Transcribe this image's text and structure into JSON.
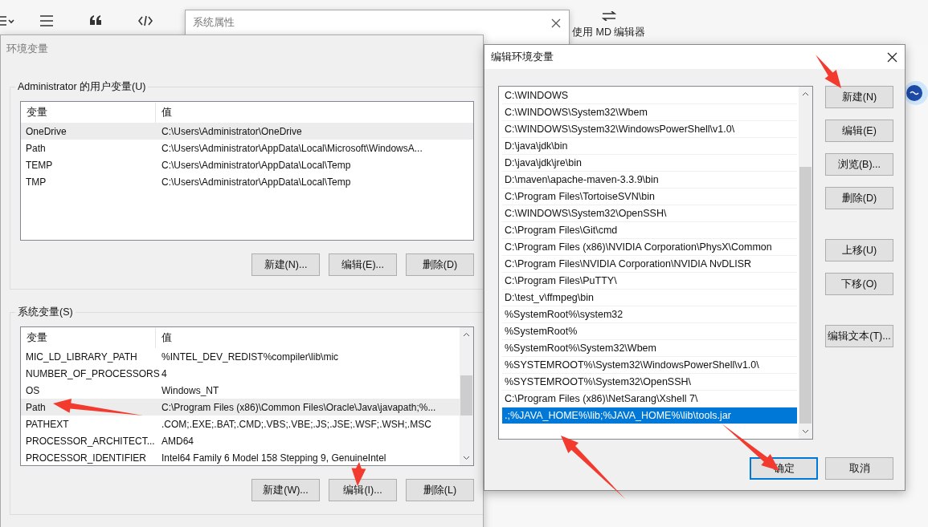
{
  "editor_toolbar": {
    "switch_label": "使用 MD 编辑器"
  },
  "system_properties_window": {
    "title": "系统属性"
  },
  "env_window": {
    "title": "环境变量",
    "user_vars": {
      "title": "Administrator 的用户变量(U)",
      "columns": [
        "变量",
        "值"
      ],
      "rows": [
        {
          "name": "OneDrive",
          "value": "C:\\Users\\Administrator\\OneDrive",
          "selected": true
        },
        {
          "name": "Path",
          "value": "C:\\Users\\Administrator\\AppData\\Local\\Microsoft\\WindowsA...",
          "selected": false
        },
        {
          "name": "TEMP",
          "value": "C:\\Users\\Administrator\\AppData\\Local\\Temp",
          "selected": false
        },
        {
          "name": "TMP",
          "value": "C:\\Users\\Administrator\\AppData\\Local\\Temp",
          "selected": false
        }
      ],
      "buttons": [
        "新建(N)...",
        "编辑(E)...",
        "删除(D)"
      ]
    },
    "system_vars": {
      "title": "系统变量(S)",
      "columns": [
        "变量",
        "值"
      ],
      "rows": [
        {
          "name": "MIC_LD_LIBRARY_PATH",
          "value": "%INTEL_DEV_REDIST%compiler\\lib\\mic",
          "selected": false
        },
        {
          "name": "NUMBER_OF_PROCESSORS",
          "value": "4",
          "selected": false
        },
        {
          "name": "OS",
          "value": "Windows_NT",
          "selected": false
        },
        {
          "name": "Path",
          "value": "C:\\Program Files (x86)\\Common Files\\Oracle\\Java\\javapath;%...",
          "selected": true
        },
        {
          "name": "PATHEXT",
          "value": ".COM;.EXE;.BAT;.CMD;.VBS;.VBE;.JS;.JSE;.WSF;.WSH;.MSC",
          "selected": false
        },
        {
          "name": "PROCESSOR_ARCHITECT...",
          "value": "AMD64",
          "selected": false
        },
        {
          "name": "PROCESSOR_IDENTIFIER",
          "value": "Intel64 Family 6 Model 158 Stepping 9, GenuineIntel",
          "selected": false
        }
      ],
      "buttons": [
        "新建(W)...",
        "编辑(I)...",
        "删除(L)"
      ]
    }
  },
  "edit_window": {
    "title": "编辑环境变量",
    "entries": [
      {
        "text": "C:\\WINDOWS",
        "selected": false
      },
      {
        "text": "C:\\WINDOWS\\System32\\Wbem",
        "selected": false
      },
      {
        "text": "C:\\WINDOWS\\System32\\WindowsPowerShell\\v1.0\\",
        "selected": false
      },
      {
        "text": "D:\\java\\jdk\\bin",
        "selected": false
      },
      {
        "text": "D:\\java\\jdk\\jre\\bin",
        "selected": false
      },
      {
        "text": "D:\\maven\\apache-maven-3.3.9\\bin",
        "selected": false
      },
      {
        "text": "C:\\Program Files\\TortoiseSVN\\bin",
        "selected": false
      },
      {
        "text": "C:\\WINDOWS\\System32\\OpenSSH\\",
        "selected": false
      },
      {
        "text": "C:\\Program Files\\Git\\cmd",
        "selected": false
      },
      {
        "text": "C:\\Program Files (x86)\\NVIDIA Corporation\\PhysX\\Common",
        "selected": false
      },
      {
        "text": "C:\\Program Files\\NVIDIA Corporation\\NVIDIA NvDLISR",
        "selected": false
      },
      {
        "text": "C:\\Program Files\\PuTTY\\",
        "selected": false
      },
      {
        "text": "D:\\test_v\\ffmpeg\\bin",
        "selected": false
      },
      {
        "text": "%SystemRoot%\\system32",
        "selected": false
      },
      {
        "text": "%SystemRoot%",
        "selected": false
      },
      {
        "text": "%SystemRoot%\\System32\\Wbem",
        "selected": false
      },
      {
        "text": "%SYSTEMROOT%\\System32\\WindowsPowerShell\\v1.0\\",
        "selected": false
      },
      {
        "text": "%SYSTEMROOT%\\System32\\OpenSSH\\",
        "selected": false
      },
      {
        "text": "C:\\Program Files (x86)\\NetSarang\\Xshell 7\\",
        "selected": false
      },
      {
        "text": ".;%JAVA_HOME%\\lib;%JAVA_HOME%\\lib\\tools.jar",
        "selected": true
      }
    ],
    "side_button_groups": [
      [
        "新建(N)",
        "编辑(E)",
        "浏览(B)...",
        "删除(D)"
      ],
      [
        "上移(U)",
        "下移(O)"
      ],
      [
        "编辑文本(T)..."
      ]
    ],
    "footer_buttons": [
      {
        "label": "确定",
        "default": true
      },
      {
        "label": "取消",
        "default": false
      }
    ]
  }
}
